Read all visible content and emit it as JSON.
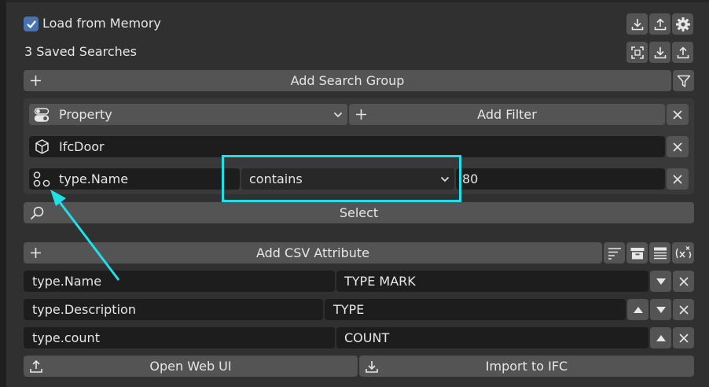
{
  "header": {
    "load_from_memory_label": "Load from Memory",
    "load_from_memory_checked": true,
    "saved_searches_label": "3 Saved Searches"
  },
  "search_group": {
    "add_search_group_label": "Add Search Group",
    "filter_type_value": "Property",
    "add_filter_label": "Add Filter",
    "entity_value": "IfcDoor",
    "property_name_value": "type.Name",
    "comparison_value": "contains",
    "filter_value": "80",
    "select_label": "Select"
  },
  "csv": {
    "add_csv_attribute_label": "Add CSV Attribute",
    "attributes": [
      {
        "name": "type.Name",
        "header": "TYPE MARK"
      },
      {
        "name": "type.Description",
        "header": "TYPE"
      },
      {
        "name": "type.count",
        "header": "COUNT"
      }
    ],
    "open_web_ui_label": "Open Web UI",
    "import_to_ifc_label": "Import to IFC"
  },
  "annotation": {
    "highlight_color": "#1fe0e8"
  },
  "colors": {
    "panel": "#303030",
    "button": "#545454",
    "field": "#1d1d1d",
    "checkbox": "#4772b3"
  }
}
